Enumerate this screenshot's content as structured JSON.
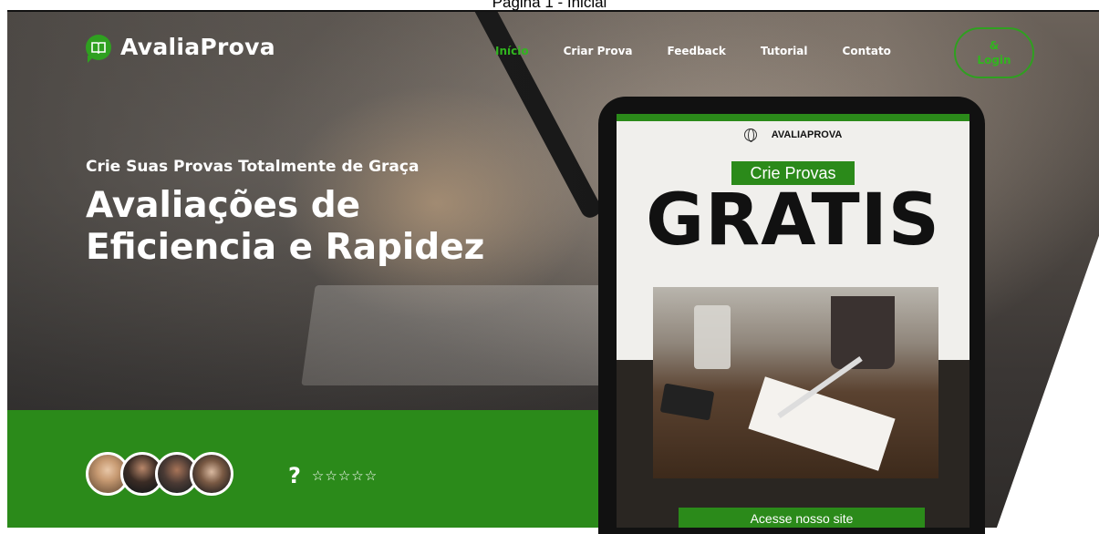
{
  "page_caption": "Pagina 1 - Inicial",
  "brand": {
    "name": "AvaliaProva",
    "icon": "book-icon",
    "accent": "#2fa020",
    "band": "#2b8a1a"
  },
  "nav": {
    "items": [
      {
        "label": "Início",
        "active": true
      },
      {
        "label": "Criar Prova",
        "active": false
      },
      {
        "label": "Feedback",
        "active": false
      },
      {
        "label": "Tutorial",
        "active": false
      },
      {
        "label": "Contato",
        "active": false
      }
    ],
    "login_icon": "&",
    "login_label": "Login"
  },
  "hero": {
    "subtitle": "Crie Suas Provas Totalmente de Graça",
    "headline_line1": "Avaliações de",
    "headline_line2": "Eficiencia e Rapidez"
  },
  "social_proof": {
    "avatars": [
      {
        "name": "avatar-woman-1"
      },
      {
        "name": "avatar-man-1"
      },
      {
        "name": "avatar-man-2"
      },
      {
        "name": "avatar-woman-2"
      }
    ],
    "rating_symbol": "?",
    "stars": "☆☆☆☆☆"
  },
  "phone_screen": {
    "brand": "AVALIAPROVA",
    "tag": "Crie Provas",
    "big_word": "GRATIS",
    "button": "Acesse nosso site"
  }
}
